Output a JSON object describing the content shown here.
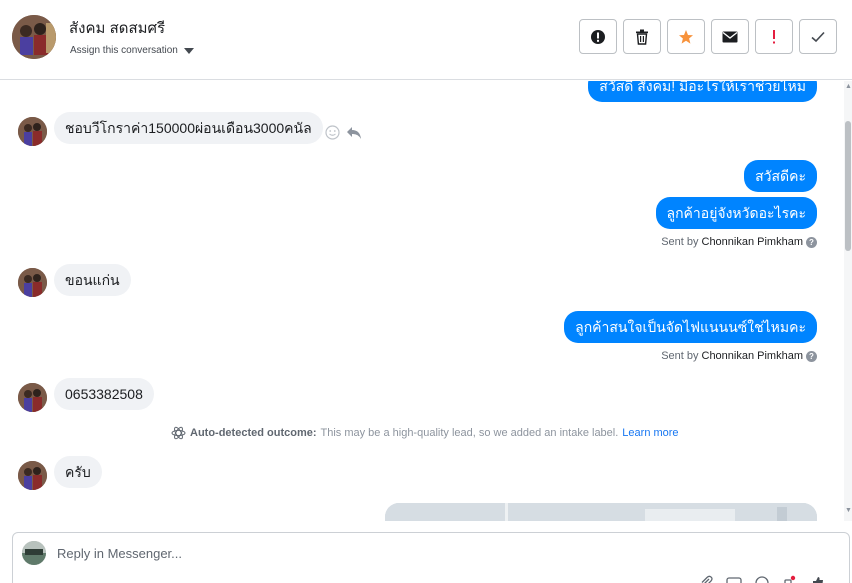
{
  "header": {
    "contact_name": "สังคม สดสมศรี",
    "assign_label": "Assign this conversation",
    "actions": [
      {
        "icon": "alert-circle-icon",
        "label": ""
      },
      {
        "icon": "trash-icon",
        "label": ""
      },
      {
        "icon": "star-icon",
        "label": ""
      },
      {
        "icon": "envelope-icon",
        "label": ""
      },
      {
        "icon": "exclamation-icon",
        "label": ""
      },
      {
        "icon": "check-icon",
        "label": ""
      }
    ]
  },
  "messages": {
    "partial_top": "สวัสดี สังคม! มีอะไรให้เราช่วยไหม",
    "m1_in": "ชอบวีโกราค่า150000ผ่อนเดือน3000คนัล",
    "m2_out": "สวัสดีคะ",
    "m3_out": "ลูกค้าอยู่จังหวัดอะไรคะ",
    "sent_by_prefix": "Sent by",
    "sender_name": "Chonnikan Pimkham",
    "m4_in": "ขอนแก่น",
    "m5_out": "ลูกค้าสนใจเป็นจัดไฟแนนนซ์ใช่ไหมคะ",
    "m6_in": "0653382508",
    "m7_in": "ครับ"
  },
  "auto_outcome": {
    "title": "Auto-detected outcome:",
    "text": "This may be a high-quality lead, so we added an intake label.",
    "link": "Learn more"
  },
  "composer": {
    "placeholder": "Reply in Messenger..."
  },
  "colors": {
    "outgoing_bubble": "#0084ff",
    "incoming_bubble": "#f0f2f5",
    "star": "#f7923b",
    "flag": "#e41e3f"
  }
}
